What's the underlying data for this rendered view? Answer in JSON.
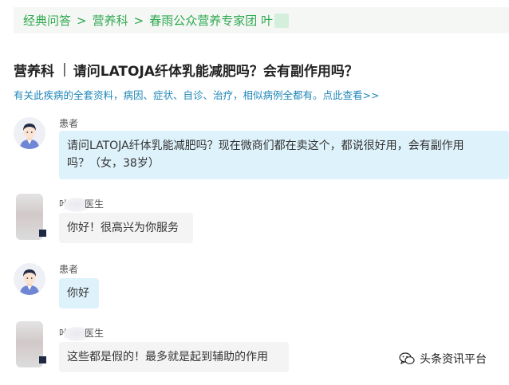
{
  "breadcrumb": {
    "items": [
      "经典问答",
      "营养科",
      "春雨公众营养专家团 叶"
    ],
    "separator": ">"
  },
  "header": {
    "department": "营养科",
    "divider": "|",
    "question": "请问LATOJA纤体乳能减肥吗？会有副作用吗？"
  },
  "promo": {
    "text": "有关此疾病的全套资料，病因、症状、自诊、治疗，相似病例全都有。点此查看>>"
  },
  "messages": [
    {
      "role": "patient",
      "sender": "患者",
      "text_lines": [
        "请问LATOJA纤体乳能减肥吗？现在微商们都在卖这个，都说很好用，会有副作用",
        "吗？（女，38岁）"
      ]
    },
    {
      "role": "doctor",
      "sender_prefix": "叶",
      "sender_suffix": "医生",
      "text": "你好！很高兴为你服务"
    },
    {
      "role": "patient",
      "sender": "患者",
      "text": "你好"
    },
    {
      "role": "doctor",
      "sender_prefix": "叶",
      "sender_suffix": "医生",
      "text": "这些都是假的！最多就是起到辅助的作用"
    }
  ],
  "watermark": {
    "text": "头条资讯平台",
    "icon": "wechat-icon"
  },
  "colors": {
    "brand_green": "#2fa84f",
    "link_blue": "#1e86b8",
    "patient_bubble": "#def2fb",
    "doctor_bubble": "#f4f4f4"
  }
}
